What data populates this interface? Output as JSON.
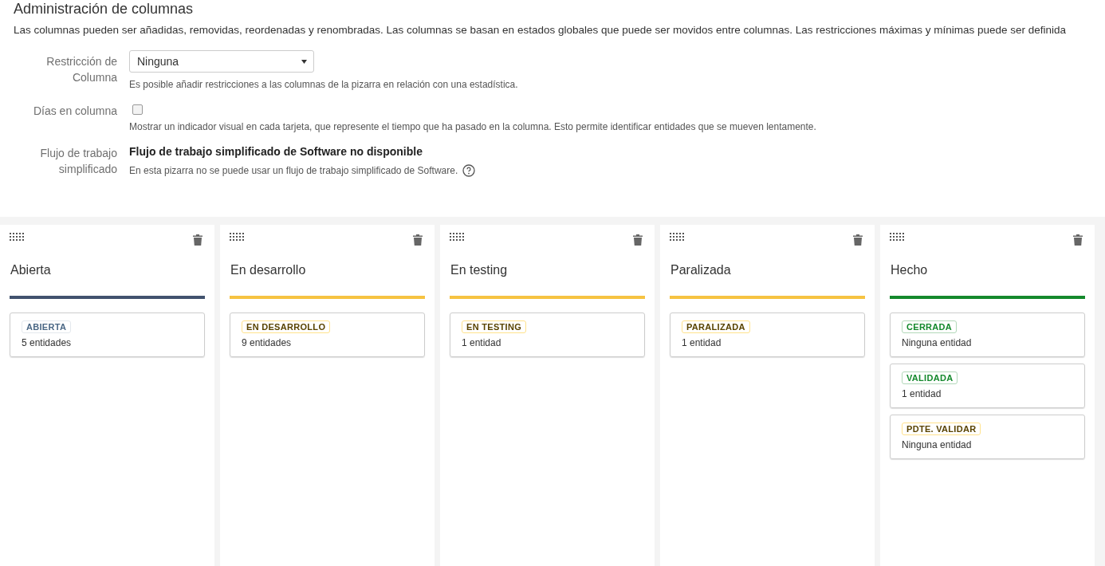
{
  "title": "Administración de columnas",
  "description": "Las columnas pueden ser añadidas, removidas, reordenadas y renombradas. Las columnas se basan en estados globales que puede ser movidos entre columnas. Las restricciones máximas y mínimas puede ser definida",
  "settings": [
    {
      "kind": "select",
      "label": "Restricción de Columna",
      "value": "Ninguna",
      "help": "Es posible añadir restricciones a las columnas de la pizarra en relación con una estadística."
    },
    {
      "kind": "checkbox",
      "label": "Días en columna",
      "checked": false,
      "help": "Mostrar un indicador visual en cada tarjeta, que represente el tiempo que ha pasado en la columna. Esto permite identificar entidades que se mueven lentamente."
    },
    {
      "kind": "text",
      "label": "Flujo de trabajo simplificado",
      "value": "Flujo de trabajo simplificado de Software no disponible",
      "help": "En esta pizarra no se puede usar un flujo de trabajo simplificado de Software."
    }
  ],
  "columns": [
    {
      "name": "Abierta",
      "kind": "todo",
      "statuses": [
        {
          "name": "ABIERTA",
          "kind": "todo",
          "count": "5 entidades"
        }
      ]
    },
    {
      "name": "En desarrollo",
      "kind": "inprogress",
      "statuses": [
        {
          "name": "EN DESARROLLO",
          "kind": "inprogress",
          "count": "9 entidades"
        }
      ]
    },
    {
      "name": "En testing",
      "kind": "inprogress",
      "statuses": [
        {
          "name": "EN TESTING",
          "kind": "inprogress",
          "count": "1 entidad"
        }
      ]
    },
    {
      "name": "Paralizada",
      "kind": "inprogress",
      "statuses": [
        {
          "name": "PARALIZADA",
          "kind": "inprogress",
          "count": "1 entidad"
        }
      ]
    },
    {
      "name": "Hecho",
      "kind": "done",
      "statuses": [
        {
          "name": "CERRADA",
          "kind": "done",
          "count": "Ninguna entidad"
        },
        {
          "name": "VALIDADA",
          "kind": "done",
          "count": "1 entidad"
        },
        {
          "name": "PDTE. VALIDAR",
          "kind": "inprogress",
          "count": "Ninguna entidad"
        }
      ]
    }
  ]
}
